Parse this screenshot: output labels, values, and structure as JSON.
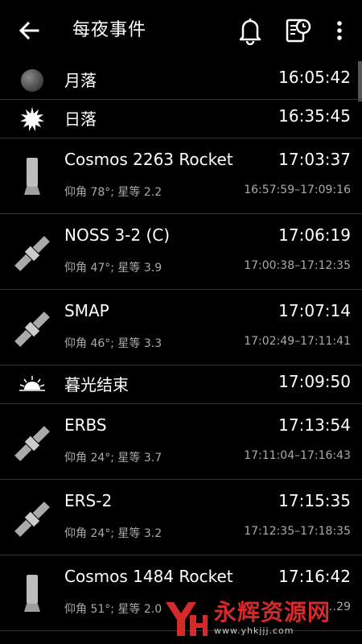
{
  "appbar": {
    "title": "每夜事件",
    "icons": [
      "back-arrow-icon",
      "bell-icon",
      "report-icon",
      "more-vert-icon"
    ]
  },
  "events": [
    {
      "type": "moon",
      "name": "月落",
      "time": "16:05:42"
    },
    {
      "type": "sun",
      "name": "日落",
      "time": "16:35:45"
    },
    {
      "type": "rocket",
      "name": "Cosmos 2263 Rocket",
      "time": "17:03:37",
      "detail": "仰角 78°; 星等 2.2",
      "range": "16:57:59–17:09:16"
    },
    {
      "type": "satellite",
      "name": "NOSS 3-2 (C)",
      "time": "17:06:19",
      "detail": "仰角 47°; 星等 3.9",
      "range": "17:00:38–17:12:35"
    },
    {
      "type": "satellite",
      "name": "SMAP",
      "time": "17:07:14",
      "detail": "仰角 46°; 星等 3.3",
      "range": "17:02:49–17:11:41"
    },
    {
      "type": "twilight",
      "name": "暮光结束",
      "time": "17:09:50"
    },
    {
      "type": "satellite",
      "name": "ERBS",
      "time": "17:13:54",
      "detail": "仰角 24°; 星等 3.7",
      "range": "17:11:04–17:16:43"
    },
    {
      "type": "satellite",
      "name": "ERS-2",
      "time": "17:15:35",
      "detail": "仰角 24°; 星等 3.2",
      "range": "17:12:35–17:18:35"
    },
    {
      "type": "rocket",
      "name": "Cosmos 1484 Rocket",
      "time": "17:16:42",
      "detail": "仰角 51°; 星等 2.0",
      "range": "…29"
    }
  ],
  "watermark": {
    "main": "永辉资源网",
    "sub": "www.yhkjjj.com"
  }
}
